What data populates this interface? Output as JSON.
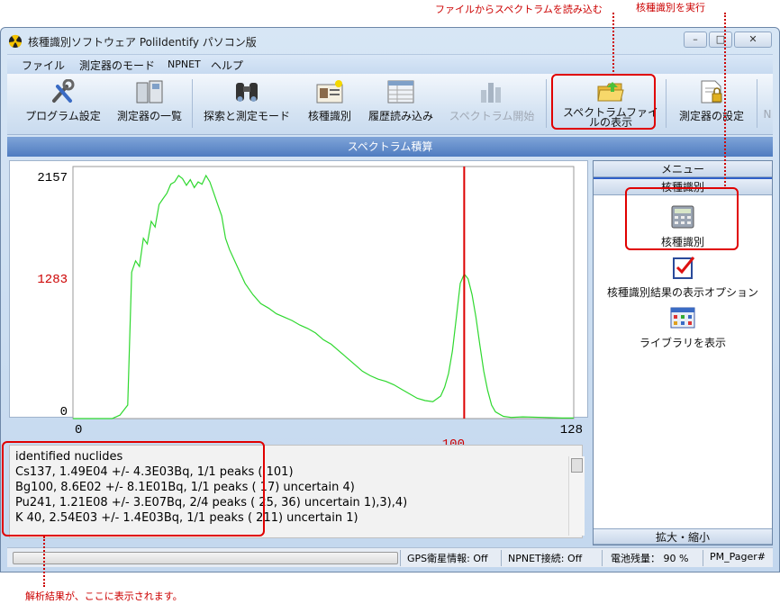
{
  "annotations": {
    "load_spectrum": "ファイルからスペクトラムを読み込む",
    "run_identify": "核種識別を実行",
    "results_note": "解析結果が、ここに表示されます。"
  },
  "window": {
    "title": "核種識別ソフトウェア PoliIdentify パソコン版",
    "minimize": "–",
    "maximize": "□",
    "close": "✕"
  },
  "menu": [
    "ファイル",
    "測定器のモード",
    "NPNET",
    "ヘルプ"
  ],
  "toolbar": {
    "program_settings": "プログラム設定",
    "device_list": "測定器の一覧",
    "search_measure": "探索と測定モード",
    "identify": "核種識別",
    "history": "履歴読み込み",
    "spectrum_start": "スペクトラム開始",
    "spectrum_file": "スペクトラムファイルの表示",
    "device_settings": "測定器の設定",
    "more": "N"
  },
  "section_title": "スペクトラム積算",
  "chart_data": {
    "type": "line",
    "x_range": [
      0,
      128
    ],
    "y_range": [
      0,
      2157
    ],
    "y_ticks": [
      "2157",
      "1283",
      "0"
    ],
    "x_ticks": [
      "0",
      "128"
    ],
    "marker_label": "100",
    "marker_x": 100,
    "series_color": "#2fd82f",
    "marker_color": "#dd0000",
    "x": [
      0,
      5,
      10,
      12,
      14,
      15,
      16,
      17,
      18,
      19,
      20,
      21,
      22,
      23,
      24,
      25,
      26,
      27,
      28,
      29,
      30,
      31,
      32,
      33,
      34,
      35,
      36,
      37,
      38,
      39,
      40,
      42,
      44,
      46,
      48,
      50,
      52,
      54,
      56,
      58,
      60,
      62,
      64,
      66,
      68,
      70,
      72,
      74,
      76,
      78,
      80,
      82,
      84,
      86,
      88,
      90,
      92,
      94,
      95,
      96,
      97,
      98,
      99,
      100,
      101,
      102,
      103,
      104,
      105,
      106,
      107,
      108,
      110,
      112,
      115,
      120,
      125,
      128
    ],
    "values": [
      0,
      0,
      0,
      30,
      120,
      1300,
      1400,
      1350,
      1600,
      1550,
      1750,
      1700,
      1900,
      1950,
      2000,
      2080,
      2100,
      2157,
      2130,
      2070,
      2120,
      2050,
      2100,
      2080,
      2157,
      2100,
      2000,
      1900,
      1800,
      1600,
      1500,
      1350,
      1200,
      1100,
      1020,
      980,
      930,
      900,
      870,
      830,
      800,
      760,
      700,
      660,
      600,
      540,
      480,
      420,
      380,
      350,
      330,
      300,
      260,
      220,
      180,
      160,
      150,
      200,
      280,
      400,
      600,
      900,
      1200,
      1283,
      1240,
      1100,
      900,
      650,
      420,
      250,
      120,
      60,
      20,
      10,
      15,
      10,
      5,
      5
    ]
  },
  "output": {
    "lines": [
      "identified nuclides",
      "Cs137, 1.49E04 +/- 4.3E03Bq, 1/1 peaks ( 101)",
      "Bg100, 8.6E02 +/- 8.1E01Bq, 1/1 peaks ( 17) uncertain 4)",
      "Pu241, 1.21E08 +/- 3.E07Bq, 2/4 peaks ( 25, 36) uncertain 1),3),4)",
      "K  40, 2.54E03 +/- 1.4E03Bq, 1/1 peaks ( 211) uncertain 1)"
    ]
  },
  "side": {
    "menu_header": "メニュー",
    "group_header": "核種識別",
    "items": [
      "核種識別",
      "核種識別結果の表示オプション",
      "ライブラリを表示"
    ],
    "zoom_header": "拡大・縮小"
  },
  "status": {
    "gps": "GPS衛星情報: Off",
    "npnet": "NPNET接続: Off",
    "battery": "電池残量： 90 %",
    "pager": "PM_Pager#"
  }
}
